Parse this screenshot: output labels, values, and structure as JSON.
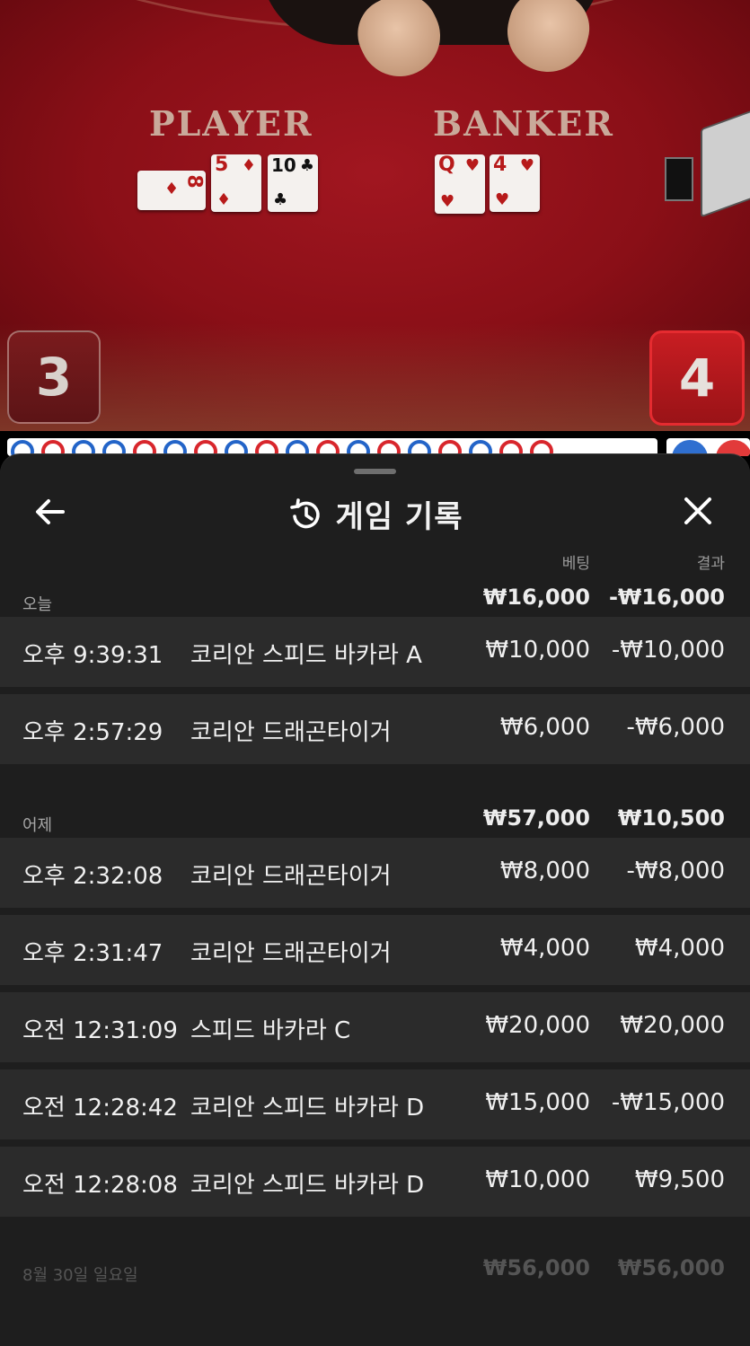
{
  "table": {
    "player_label": "PLAYER",
    "banker_label": "BANKER",
    "player_score": "3",
    "banker_score": "4",
    "player_cards": [
      {
        "rank": "8",
        "suit": "♦",
        "color": "red"
      },
      {
        "rank": "5",
        "suit": "♦",
        "color": "red"
      },
      {
        "rank": "10",
        "suit": "♣",
        "color": "black"
      }
    ],
    "banker_cards": [
      {
        "rank": "Q",
        "suit": "♥",
        "color": "red"
      },
      {
        "rank": "4",
        "suit": "♥",
        "color": "red"
      }
    ],
    "roadmap": [
      "P",
      "B",
      "P",
      "P",
      "B",
      "P",
      "B",
      "P",
      "B",
      "P",
      "B",
      "P",
      "B",
      "P",
      "B",
      "P",
      "B",
      "B"
    ]
  },
  "sheet": {
    "title": "게임 기록",
    "icons": {
      "back": "arrow-left-icon",
      "history": "history-icon",
      "close": "close-icon"
    },
    "col_bet": "베팅",
    "col_result": "결과",
    "groups": [
      {
        "label": "오늘",
        "bet_total": "₩16,000",
        "result_total": "-₩16,000",
        "rows": [
          {
            "time": "오후 9:39:31",
            "game": "코리안 스피드 바카라 A",
            "bet": "₩10,000",
            "result": "-₩10,000"
          },
          {
            "time": "오후 2:57:29",
            "game": "코리안 드래곤타이거",
            "bet": "₩6,000",
            "result": "-₩6,000"
          }
        ]
      },
      {
        "label": "어제",
        "bet_total": "₩57,000",
        "result_total": "₩10,500",
        "rows": [
          {
            "time": "오후 2:32:08",
            "game": "코리안 드래곤타이거",
            "bet": "₩8,000",
            "result": "-₩8,000"
          },
          {
            "time": "오후 2:31:47",
            "game": "코리안 드래곤타이거",
            "bet": "₩4,000",
            "result": "₩4,000"
          },
          {
            "time": "오전 12:31:09",
            "game": "스피드 바카라 C",
            "bet": "₩20,000",
            "result": "₩20,000"
          },
          {
            "time": "오전 12:28:42",
            "game": "코리안 스피드 바카라 D",
            "bet": "₩15,000",
            "result": "-₩15,000"
          },
          {
            "time": "오전 12:28:08",
            "game": "코리안 스피드 바카라 D",
            "bet": "₩10,000",
            "result": "₩9,500"
          }
        ]
      },
      {
        "label": "8월 30일 일요일",
        "bet_total": "₩56,000",
        "result_total": "₩56,000",
        "rows": []
      }
    ]
  }
}
